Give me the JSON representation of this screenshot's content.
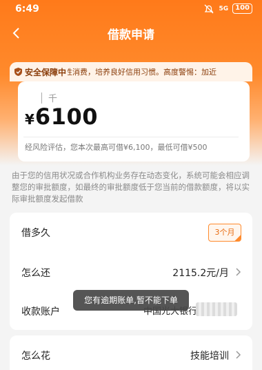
{
  "status_bar": {
    "time": "6:49",
    "signal": "5G",
    "battery": "100"
  },
  "nav": {
    "title": "借款申请"
  },
  "notice": {
    "label": "安全保障中",
    "text": "倡理性消费，培养良好信用习惯。高度警惕：加近"
  },
  "amount": {
    "unit_hint": "千",
    "currency": "¥",
    "value": "6100",
    "note": "经风险评估，您本次最高可借¥6,100，最低可借¥500"
  },
  "description": "由于您的信用状况或合作机构业务存在动态变化，系统可能会相应调整您的审批额度，如最终的审批额度低于您当前的借款额度，将以实际审批额度发起借款",
  "rows": [
    {
      "label": "借多久",
      "value": "3个月"
    },
    {
      "label": "怎么还",
      "value": "2115.2元/月"
    },
    {
      "label": "收款账户",
      "value": "中国光大银行"
    }
  ],
  "usage": {
    "label": "怎么花",
    "value": "技能培训"
  },
  "toast": "您有逾期账单,暂不能下单",
  "colors": {
    "brand": "#ff7a1a",
    "accent_text": "#e86b10"
  }
}
